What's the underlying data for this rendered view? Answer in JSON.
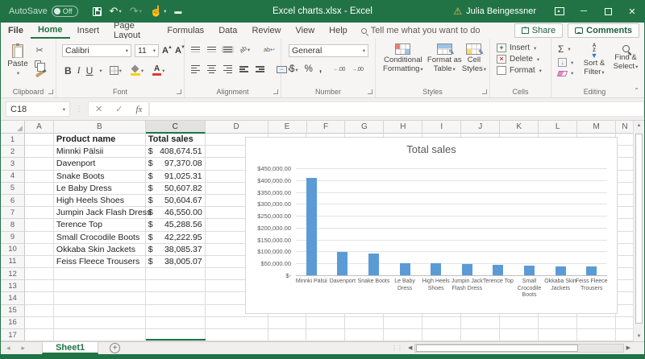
{
  "titlebar": {
    "autosave_label": "AutoSave",
    "autosave_state": "Off",
    "title": "Excel charts.xlsx - Excel",
    "user": "Julia Beingessner"
  },
  "tabs": {
    "items": [
      "File",
      "Home",
      "Insert",
      "Page Layout",
      "Formulas",
      "Data",
      "Review",
      "View",
      "Help"
    ],
    "active": "Home",
    "search_placeholder": "Tell me what you want to do",
    "share_label": "Share",
    "comments_label": "Comments"
  },
  "ribbon": {
    "paste_label": "Paste",
    "font_name": "Calibri",
    "font_size": "11",
    "bold": "B",
    "italic": "I",
    "underline": "U",
    "number_format": "General",
    "currency": "$",
    "percent": "%",
    "comma": ",",
    "conditional_formatting": "Conditional Formatting",
    "format_as_table": "Format as Table",
    "cell_styles": "Cell Styles",
    "insert_label": "Insert",
    "delete_label": "Delete",
    "format_label": "Format",
    "autosum": "Σ",
    "sort_filter": "Sort & Filter",
    "find_select": "Find & Select",
    "groups": {
      "clipboard": "Clipboard",
      "font": "Font",
      "alignment": "Alignment",
      "number": "Number",
      "styles": "Styles",
      "cells": "Cells",
      "editing": "Editing"
    }
  },
  "formula_bar": {
    "name_box": "C18",
    "fx_label": "fx",
    "formula": ""
  },
  "sheet": {
    "columns": [
      "A",
      "B",
      "C",
      "D",
      "E",
      "F",
      "G",
      "H",
      "I",
      "J",
      "K",
      "L",
      "M",
      "N"
    ],
    "selected_column": "C",
    "selected_cell": "C18",
    "visible_rows": 17,
    "headers": {
      "product": "Product name",
      "sales": "Total sales"
    },
    "currency_symbol": "$",
    "products": [
      {
        "name": "Minnki Pälsii",
        "sales": "408,674.51"
      },
      {
        "name": "Davenport",
        "sales": "97,370.08"
      },
      {
        "name": "Snake Boots",
        "sales": "91,025.31"
      },
      {
        "name": "Le Baby Dress",
        "sales": "50,607.82"
      },
      {
        "name": "High Heels Shoes",
        "sales": "50,604.67"
      },
      {
        "name": "Jumpin Jack Flash Dress",
        "sales": "46,550.00"
      },
      {
        "name": "Terence Top",
        "sales": "45,288.56"
      },
      {
        "name": "Small Crocodile Boots",
        "sales": "42,222.95"
      },
      {
        "name": "Okkaba Skin Jackets",
        "sales": "38,085.37"
      },
      {
        "name": "Feiss Fleece Trousers",
        "sales": "38,005.07"
      }
    ]
  },
  "chart_data": {
    "type": "bar",
    "title": "Total sales",
    "categories": [
      "Minnki Pälsii",
      "Davenport",
      "Snake Boots",
      "Le Baby Dress",
      "High Heels Shoes",
      "Jumpin Jack Flash Dress",
      "Terence Top",
      "Small Crocodile Boots",
      "Okkaba Skin Jackets",
      "Feiss Fleece Trousers"
    ],
    "values": [
      408674.51,
      97370.08,
      91025.31,
      50607.82,
      50604.67,
      46550.0,
      45288.56,
      42222.95,
      38085.37,
      38005.07
    ],
    "y_tick_labels": [
      "$450,000.00",
      "$400,000.00",
      "$350,000.00",
      "$300,000.00",
      "$250,000.00",
      "$200,000.00",
      "$150,000.00",
      "$100,000.00",
      "$50,000.00",
      "$-"
    ],
    "ylim": [
      0,
      450000
    ],
    "xlabel": "",
    "ylabel": "",
    "grid": true,
    "legend": false,
    "bar_color": "#5B9BD5"
  },
  "tabbar": {
    "sheet_name": "Sheet1"
  },
  "colors": {
    "brand_green": "#217346",
    "bar_blue": "#5B9BD5",
    "warning_yellow": "#F6C244"
  },
  "icons": {
    "warning": "⚠",
    "caret": "▾",
    "scissors": "✂",
    "autosum": "Σ",
    "undo": "↶",
    "redo": "↷",
    "cancel": "✕",
    "enter": "✓",
    "prev_sheet": "◂",
    "next_sheet": "▸",
    "scroll_up": "▲",
    "scroll_down": "▼",
    "add_sheet": "+"
  }
}
